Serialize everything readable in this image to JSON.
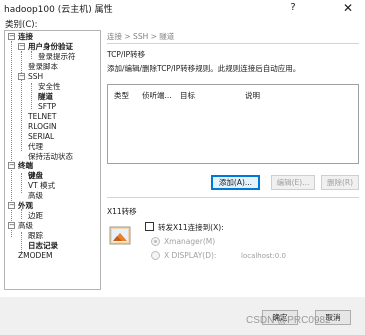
{
  "window": {
    "title": "hadoop100 (云主机) 属性",
    "help_symbol": "?",
    "close_symbol": "✕"
  },
  "category_label": "类别(C):",
  "tree": {
    "connection": "连接",
    "user_auth": "用户身份验证",
    "login_prompt": "登录提示符",
    "login_script": "登录脚本",
    "ssh": "SSH",
    "security": "安全性",
    "tunnel": "隧道",
    "sftp": "SFTP",
    "telnet": "TELNET",
    "rlogin": "RLOGIN",
    "serial": "SERIAL",
    "proxy": "代理",
    "keepalive": "保持活动状态",
    "terminal": "终端",
    "keyboard": "键盘",
    "vt_mode": "VT 模式",
    "advanced_term": "高级",
    "appearance": "外观",
    "margin": "边距",
    "advanced": "高级",
    "trace": "跟踪",
    "logging": "日志记录",
    "zmodem": "ZMODEM"
  },
  "breadcrumb": "连接 > SSH > 隧道",
  "tcpip": {
    "section_title": "TCP/IP转移",
    "description": "添加/编辑/删除TCP/IP转移规则。此规则连接后自动应用。",
    "columns": [
      "类型",
      "侦听端...",
      "目标",
      "说明"
    ],
    "add_button": "添加(A)...",
    "edit_button": "编辑(E)...",
    "delete_button": "删除(R)"
  },
  "x11": {
    "section_title": "X11转移",
    "forward_label": "转发X11连接到(X):",
    "xmanager_label": "Xmanager(M)",
    "xdisplay_label": "X DISPLAY(D):",
    "xdisplay_value": "localhost:0.0"
  },
  "footer": {
    "confirm_button": "确定",
    "cancel_button": "取消"
  },
  "watermark": "CSDN @PRC0982"
}
